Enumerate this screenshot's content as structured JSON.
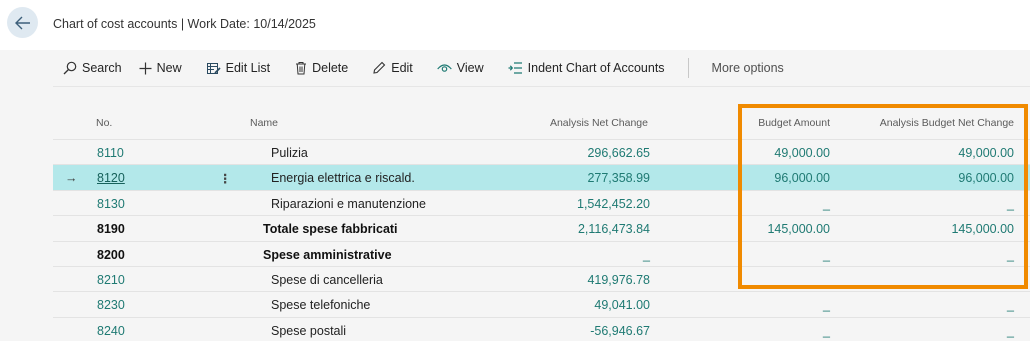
{
  "header": {
    "title": "Chart of cost accounts | Work Date: 10/14/2025"
  },
  "actions": {
    "search": "Search",
    "new": "New",
    "edit_list": "Edit List",
    "delete": "Delete",
    "edit": "Edit",
    "view": "View",
    "indent": "Indent Chart of Accounts",
    "more": "More options"
  },
  "columns": {
    "no": "No.",
    "name": "Name",
    "analysis_net_change": "Analysis Net Change",
    "budget_amount": "Budget Amount",
    "analysis_budget_net_change": "Analysis Budget Net Change"
  },
  "rows": [
    {
      "no": "8110",
      "name": "Pulizia",
      "anc": "296,662.65",
      "budget": "49,000.00",
      "abnc": "49,000.00"
    },
    {
      "no": "8120",
      "name": "Energia elettrica e riscald.",
      "anc": "277,358.99",
      "budget": "96,000.00",
      "abnc": "96,000.00",
      "arrow": "→",
      "dots": "⋮"
    },
    {
      "no": "8130",
      "name": "Riparazioni e manutenzione",
      "anc": "1,542,452.20",
      "budget": "_",
      "abnc": "_"
    },
    {
      "no": "8190",
      "name": "Totale spese fabbricati",
      "anc": "2,116,473.84",
      "budget": "145,000.00",
      "abnc": "145,000.00"
    },
    {
      "no": "8200",
      "name": "Spese amministrative",
      "anc": "_",
      "budget": "_",
      "abnc": "_"
    },
    {
      "no": "8210",
      "name": "Spese di cancelleria",
      "anc": "419,976.78",
      "budget": "",
      "abnc": ""
    },
    {
      "no": "8230",
      "name": "Spese telefoniche",
      "anc": "49,041.00",
      "budget": "_",
      "abnc": "_"
    },
    {
      "no": "8240",
      "name": "Spese postali",
      "anc": "-56,946.67",
      "budget": "_",
      "abnc": "_"
    }
  ],
  "colors": {
    "accent": "#1f7a73",
    "selected_row": "#b3e8ea",
    "highlight_box": "#f08a00"
  }
}
